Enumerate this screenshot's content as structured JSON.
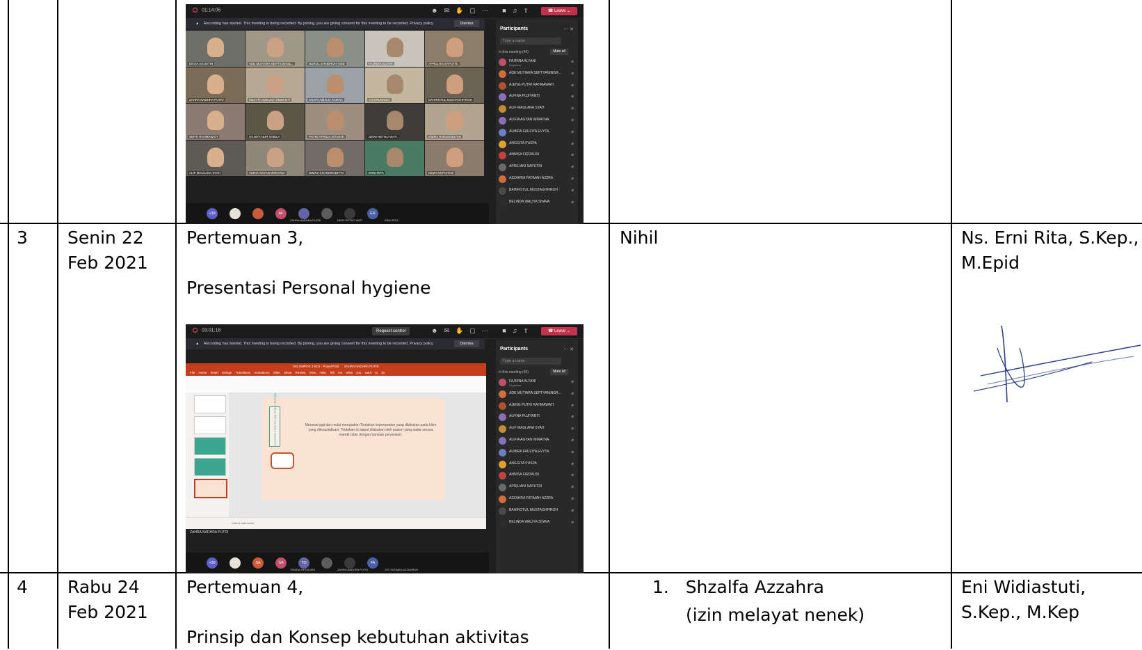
{
  "rows": [
    {
      "no": "3",
      "day": "Senin 22",
      "date": "Feb 2021",
      "content_line1": "Pertemuan 3,",
      "content_line2": "Presentasi Personal hygiene",
      "notes": "Nihil",
      "lecturer_line1": "Ns. Erni Rita, S.Kep.,",
      "lecturer_line2": "M.Epid"
    },
    {
      "no": "4",
      "day": "Rabu 24",
      "date": "Feb 2021",
      "content_line1": "Pertemuan 4,",
      "content_line2": "Prinsip dan Konsep kebutuhan aktivitas",
      "notes_item": "1.   Shzalfa Azzahra",
      "notes_item_sub": "(izin melayat nenek)",
      "lecturer_line1": "Eni Widiastuti,",
      "lecturer_line2": "S.Kep., M.Kep"
    }
  ],
  "teams1": {
    "timer": "01:14:05",
    "leave": "Leave",
    "banner": "Recording has started.  This meeting is being recorded. By joining, you are giving consent for this meeting to be recorded. Privacy policy",
    "dismiss": "Dismiss",
    "participants_title": "Participants",
    "search_placeholder": "Type a name",
    "in_meeting": "In this meeting (46)",
    "mute_all": "Mute all",
    "tiles": [
      "DEVIA AGUSTIN",
      "ADE MUTIARA SEPTYANING...",
      "NURUL SHABIROH NISE",
      "FAJRINA ALYANI",
      "APRILIANI SAPUTRI",
      "ZAHRA NADHRA PUTRI",
      "MELYTA ADELINA DEWANTI",
      "SHAFA AMALIA TAZHIA",
      "KHAIRUNNISA",
      "BAHIROTUL MUSTAGHFIROH",
      "SEPTI RAHMAWATI",
      "OCHITA NUR SABILA",
      "PUTRI AFRILIA ISTIANTI",
      "DEWI RETNO WATI",
      "INDRA HARDIANSYAH",
      "ALIF MAULANA SYAH",
      "AURIA AGYAN WIRATNA",
      "DIMAS CHANDRADITYA",
      "ERNI RITA",
      "DEWI OKTAVIANI"
    ],
    "bottom": [
      "+39",
      "",
      "",
      "AF",
      "",
      "",
      "",
      "ER"
    ],
    "bottom_labels": [
      "ZAHRA NADHRA PUTRI",
      "DEWI RETNO WATI",
      "ERNI RITA"
    ]
  },
  "teams2": {
    "timer": "03:01:18",
    "request_control": "Request control",
    "leave": "Leave",
    "banner": "Recording has started.  This meeting is being recorded. By joining, you are giving consent for this meeting to be recorded. Privacy policy",
    "dismiss": "Dismiss",
    "participants_title": "Participants",
    "search_placeholder": "Type a name",
    "in_meeting": "In this meeting (45)",
    "mute_all": "Mute all",
    "ppt_title": "KELOMPOK 3 KD1 - PowerPoint",
    "ppt_user": "ZAHRA NADHRA PUTRI",
    "ppt_tabs": "File  Home  Insert  Design  Transitions  Animations  Slide Show  Review  View  Help  Tell me what you want to do",
    "slide_text": "Merawat gigi dan mulut merupakan Tindakan keperawatan yang dilakukan pada klien yang dihospitalisasi. Tindakan ini dapat dilakukan oleh pasien yang sadar secara mandiri atau dengan bantuan perawatan.",
    "slide_vertical": "perawatan mulut dan gigi dengan sikat gigi",
    "notes_hint": "Click to add notes",
    "presenter": "ZAHRA NADHRA PUTRI",
    "bottom": [
      "+38",
      "",
      "SA",
      "SA",
      "TO",
      "",
      "",
      "FA"
    ],
    "bottom_labels": [
      "TRIANA OKTAVIANI",
      "ZAHRA NADHRA PUTRI",
      "SITI FATIMAH AZZAHRAH"
    ]
  },
  "participants": [
    "FAJRINA ALYANI",
    "ADE MUTIARA SEPTYANINGR...",
    "AJENG PUTRI RAHMAWATI",
    "ALFINA PUJIYANTI",
    "ALIF MAULANA SYAH",
    "ALIFIA AGYAN WIRATNA",
    "ALMIRA FAUZIYA EVYTA",
    "ANGGITA PUSPA",
    "ANNISA FIRDAUSI",
    "APRILIANI SAPUTRI",
    "AZZAHRA FATIMAH AZZRA",
    "BAHIROTUL MUSTAGHFIROH",
    "BELINDA WALIYA SHAVA"
  ],
  "organizer_label": "Organizer"
}
